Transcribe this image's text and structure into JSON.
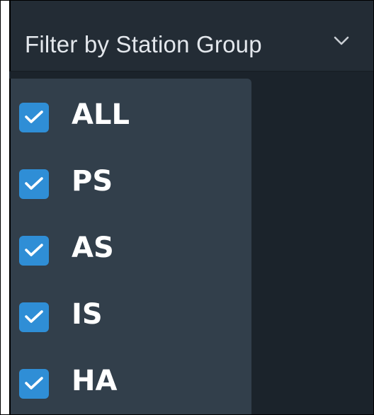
{
  "filter_dropdown": {
    "label": "Filter by Station Group",
    "icon": "chevron-down-icon",
    "options": [
      {
        "label": "ALL",
        "checked": true
      },
      {
        "label": "PS",
        "checked": true
      },
      {
        "label": "AS",
        "checked": true
      },
      {
        "label": "IS",
        "checked": true
      },
      {
        "label": "HA",
        "checked": true
      }
    ]
  },
  "colors": {
    "header_background": "#232c35",
    "menu_background": "#323f4b",
    "page_background": "#1b232b",
    "checkbox_fill": "#2f8ed6",
    "label_text": "#ffffff"
  }
}
